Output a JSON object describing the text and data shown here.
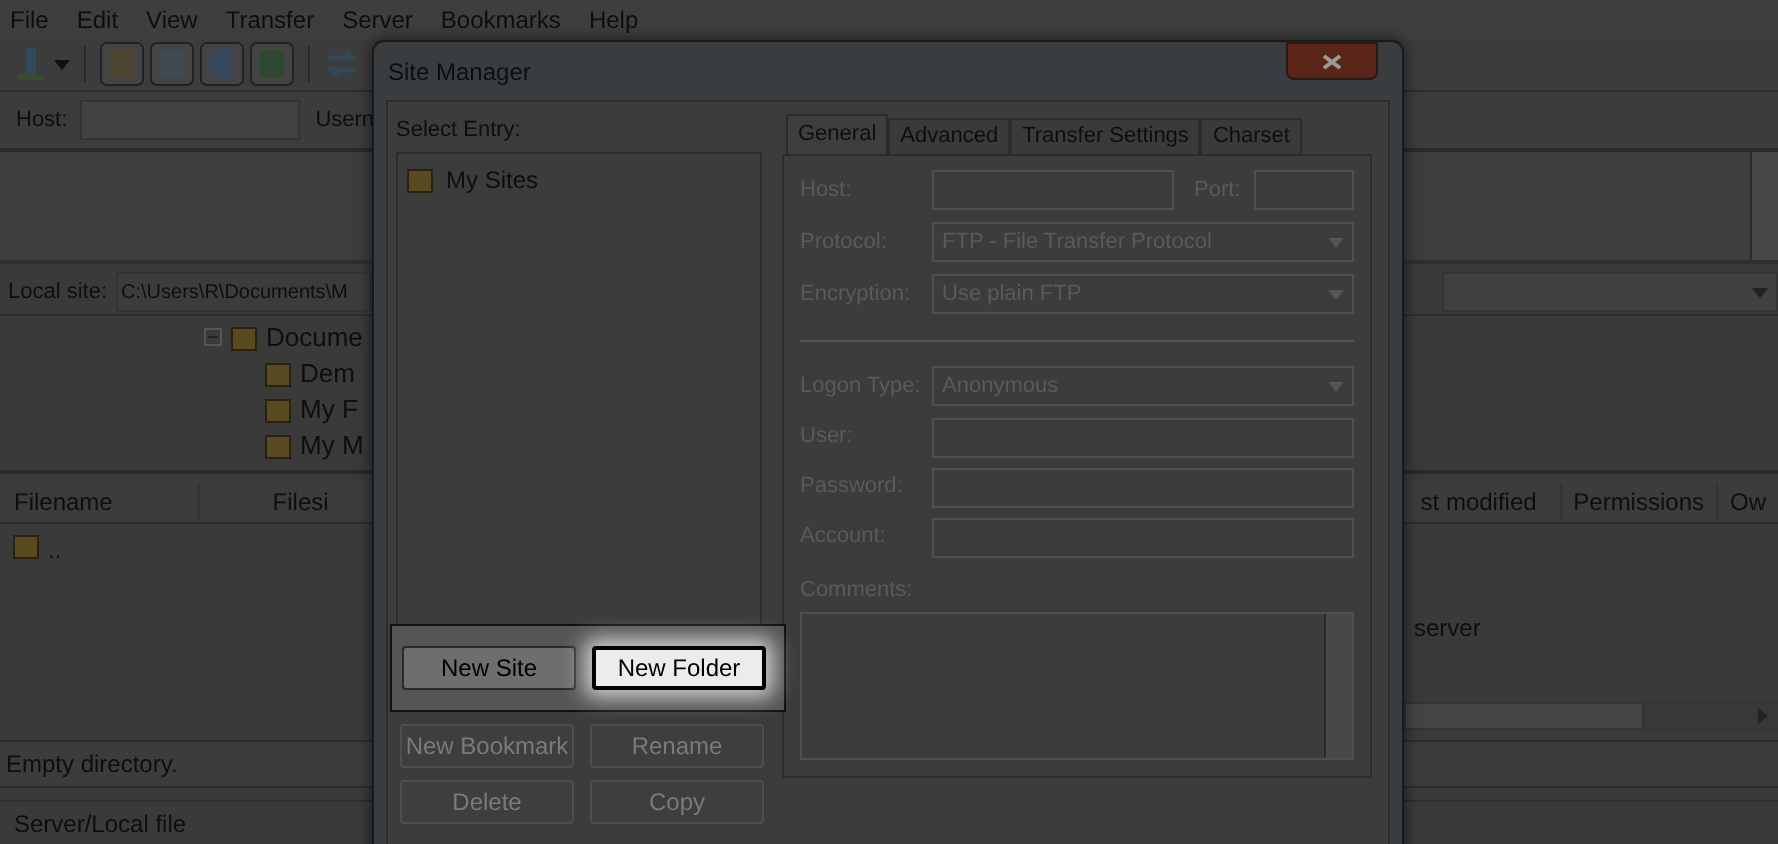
{
  "menu_bar": [
    "File",
    "Edit",
    "View",
    "Transfer",
    "Server",
    "Bookmarks",
    "Help"
  ],
  "quickconnect": {
    "host_label": "Host:",
    "username_label": "Usern"
  },
  "local_site": {
    "label": "Local site:",
    "path": "C:\\Users\\R\\Documents\\M"
  },
  "local_tree": [
    {
      "label": "Docume",
      "expanded": true,
      "children": [
        {
          "label": "Dem"
        },
        {
          "label": "My F"
        },
        {
          "label": "My M"
        }
      ]
    }
  ],
  "local_files": {
    "columns": [
      "Filename",
      "Filesi"
    ],
    "rows": [
      ".."
    ]
  },
  "remote_files": {
    "columns": [
      "st modified",
      "Permissions",
      "Ow"
    ],
    "message": "server"
  },
  "local_status": "Empty directory.",
  "queue_columns": [
    "Server/Local file"
  ],
  "dialog": {
    "title": "Site Manager",
    "select_entry_label": "Select Entry:",
    "tree": [
      {
        "label": "My Sites"
      }
    ],
    "buttons": [
      {
        "label": "New Site",
        "disabled": false,
        "highlighted": false
      },
      {
        "label": "New Folder",
        "disabled": false,
        "highlighted": true
      },
      {
        "label": "New Bookmark",
        "disabled": true,
        "highlighted": false
      },
      {
        "label": "Rename",
        "disabled": true,
        "highlighted": false
      },
      {
        "label": "Delete",
        "disabled": true,
        "highlighted": false
      },
      {
        "label": "Copy",
        "disabled": true,
        "highlighted": false
      }
    ],
    "tabs": [
      {
        "label": "General",
        "selected": true
      },
      {
        "label": "Advanced",
        "selected": false
      },
      {
        "label": "Transfer Settings",
        "selected": false
      },
      {
        "label": "Charset",
        "selected": false
      }
    ],
    "fields": [
      {
        "kind": "host",
        "label": "Host:",
        "port_label": "Port:",
        "disabled": true
      },
      {
        "kind": "select",
        "label": "Protocol:",
        "value": "FTP - File Transfer Protocol",
        "disabled": true
      },
      {
        "kind": "select",
        "label": "Encryption:",
        "value": "Use plain FTP",
        "disabled": true
      },
      {
        "kind": "separator"
      },
      {
        "kind": "select",
        "label": "Logon Type:",
        "value": "Anonymous",
        "disabled": true
      },
      {
        "kind": "text",
        "label": "User:",
        "disabled": true
      },
      {
        "kind": "text",
        "label": "Password:",
        "disabled": true
      },
      {
        "kind": "text",
        "label": "Account:",
        "disabled": true
      }
    ],
    "comments_label": "Comments:"
  }
}
